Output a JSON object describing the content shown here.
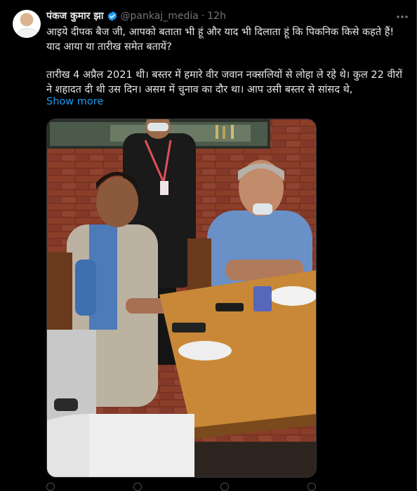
{
  "tweet": {
    "author_name": "पंकज कुमार झा",
    "handle": "@pankaj_media",
    "separator": "·",
    "time": "12h",
    "more_icon": "ellipsis-icon",
    "verified_color": "#1d9bf0",
    "text_line1": "आइये दीपक बैज जी, आपको बताता भी हूं और याद भी दिलाता हूं कि पिकनिक किसे कहते हैं! याद आया या तारीख समेत बतायें?",
    "text_line2": "तारीख 4 अप्रैल 2021 थी। बस्तर में हमारे वीर जवान नक्सलियों से लोहा ले रहे थे। कुल 22 वीरों ने शहादत दी थी उस दिन। असम में चुनाव का दौर था। आप उसी बस्तर से सांसद थे,",
    "show_more": "Show more",
    "link_color": "#1d9bf0"
  }
}
